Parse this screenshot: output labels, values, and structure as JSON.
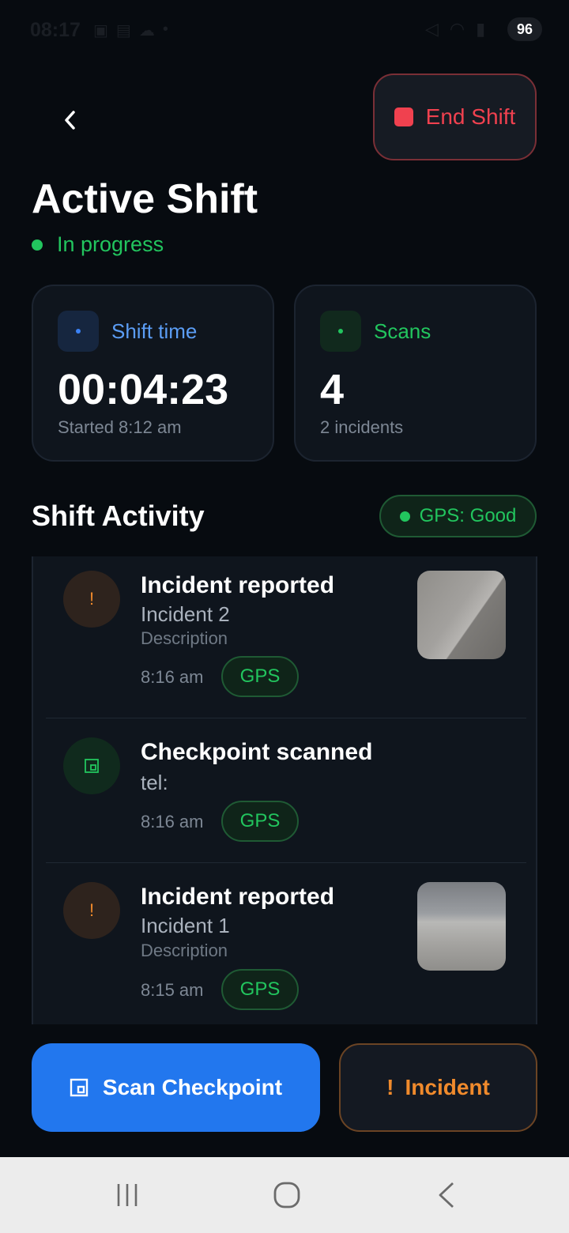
{
  "status_bar": {
    "time": "08:17",
    "battery": "96"
  },
  "header": {
    "end_shift_label": "End Shift"
  },
  "page": {
    "title": "Active Shift",
    "status": "In progress"
  },
  "stats": {
    "shift_time": {
      "label": "Shift time",
      "value": "00:04:23",
      "sub": "Started 8:12 am"
    },
    "scans": {
      "label": "Scans",
      "value": "4",
      "sub": "2 incidents"
    }
  },
  "activity": {
    "title": "Shift Activity",
    "gps_status": "GPS: Good",
    "items": [
      {
        "type": "incident",
        "icon": "exclamation-icon",
        "title": "Incident reported",
        "subtitle": "Incident 2",
        "description": "Description",
        "time": "8:16 am",
        "badge": "GPS",
        "has_photo": true
      },
      {
        "type": "checkpoint",
        "icon": "qr-scan-icon",
        "title": "Checkpoint scanned",
        "subtitle": "tel:",
        "time": "8:16 am",
        "badge": "GPS",
        "has_photo": false
      },
      {
        "type": "incident",
        "icon": "exclamation-icon",
        "title": "Incident reported",
        "subtitle": "Incident 1",
        "description": "Description",
        "time": "8:15 am",
        "badge": "GPS",
        "has_photo": true
      }
    ]
  },
  "actions": {
    "scan_label": "Scan Checkpoint",
    "incident_mark": "!",
    "incident_label": "Incident"
  },
  "colors": {
    "background": "#070b10",
    "danger": "#f0414f",
    "success": "#22c55e",
    "primary": "#2277ee",
    "warning": "#f08a2c",
    "card": "#0f151d"
  }
}
